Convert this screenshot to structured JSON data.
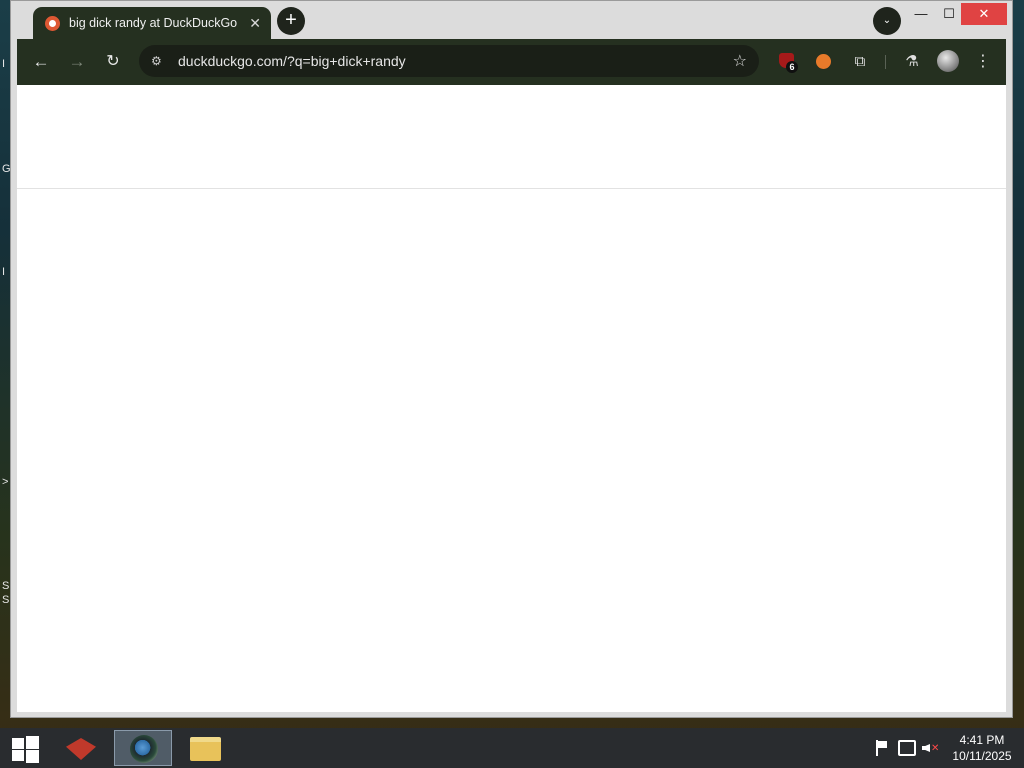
{
  "desktop": {
    "edge_glyphs": [
      "G",
      "I",
      ">",
      "S",
      "S"
    ]
  },
  "browser": {
    "tab": {
      "title": "big dick randy at DuckDuckGo",
      "close_glyph": "✕",
      "favicon": "duckduckgo-icon"
    },
    "new_tab_glyph": "+",
    "tab_search_glyph": "⌄",
    "window_controls": {
      "minimize": "—",
      "maximize": "☐",
      "close": "✕"
    },
    "toolbar": {
      "back_glyph": "←",
      "forward_glyph": "→",
      "reload_glyph": "↻",
      "site_info_glyph": "⚙",
      "url": "duckduckgo.com/?q=big+dick+randy",
      "bookmark_glyph": "☆",
      "extensions": [
        {
          "name": "ublock-shield-icon",
          "badge": "6"
        },
        {
          "name": "orange-extension-icon"
        },
        {
          "name": "puzzle-icon",
          "glyph": "⧉"
        },
        {
          "name": "labs-flask-icon",
          "glyph": "⚗"
        }
      ],
      "menu_glyph": "⋮"
    },
    "colors": {
      "frame": "#253020",
      "tabstrip": "#dcdcdc",
      "close_red": "#e04343"
    }
  },
  "taskbar": {
    "apps": [
      "start-button",
      "red-box-app",
      "chrome-app",
      "file-explorer-app"
    ],
    "clock": {
      "time": "4:41 PM",
      "date": "10/11/2025"
    }
  }
}
